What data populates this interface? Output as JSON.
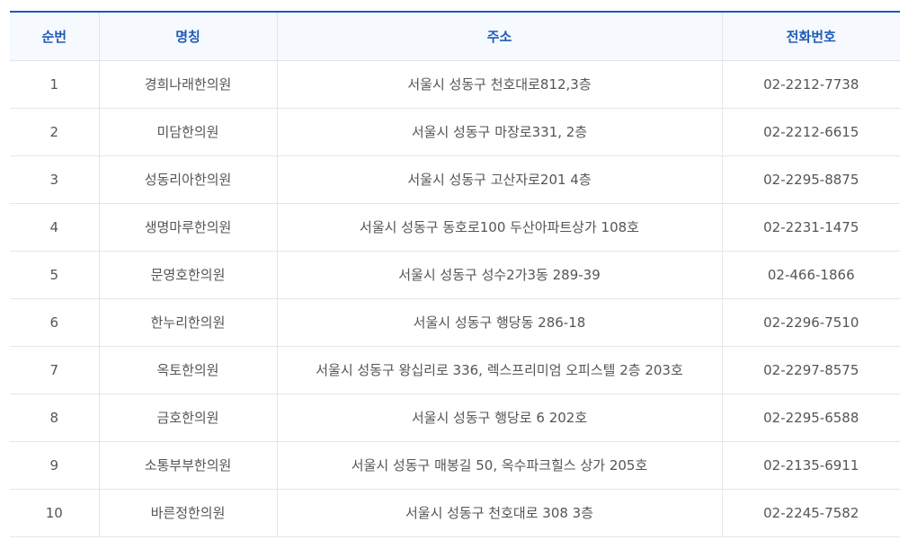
{
  "table": {
    "headers": {
      "no": "순번",
      "name": "명칭",
      "address": "주소",
      "phone": "전화번호"
    },
    "rows": [
      {
        "no": "1",
        "name": "경희나래한의원",
        "address": "서울시 성동구 천호대로812,3층",
        "phone": "02-2212-7738"
      },
      {
        "no": "2",
        "name": "미담한의원",
        "address": "서울시 성동구 마장로331, 2층",
        "phone": "02-2212-6615"
      },
      {
        "no": "3",
        "name": "성동리아한의원",
        "address": "서울시 성동구 고산자로201 4층",
        "phone": "02-2295-8875"
      },
      {
        "no": "4",
        "name": "생명마루한의원",
        "address": "서울시 성동구 동호로100 두산아파트상가 108호",
        "phone": "02-2231-1475"
      },
      {
        "no": "5",
        "name": "문영호한의원",
        "address": "서울시 성동구 성수2가3동 289-39",
        "phone": "02-466-1866"
      },
      {
        "no": "6",
        "name": "한누리한의원",
        "address": "서울시 성동구 행당동 286-18",
        "phone": "02-2296-7510"
      },
      {
        "no": "7",
        "name": "옥토한의원",
        "address": "서울시 성동구 왕십리로 336, 렉스프리미엄 오피스텔 2층 203호",
        "phone": "02-2297-8575"
      },
      {
        "no": "8",
        "name": "금호한의원",
        "address": "서울시 성동구 행당로 6 202호",
        "phone": "02-2295-6588"
      },
      {
        "no": "9",
        "name": "소통부부한의원",
        "address": "서울시 성동구 매봉길 50, 옥수파크힐스 상가 205호",
        "phone": "02-2135-6911"
      },
      {
        "no": "10",
        "name": "바른정한의원",
        "address": "서울시 성동구 천호대로 308 3층",
        "phone": "02-2245-7582"
      }
    ]
  }
}
